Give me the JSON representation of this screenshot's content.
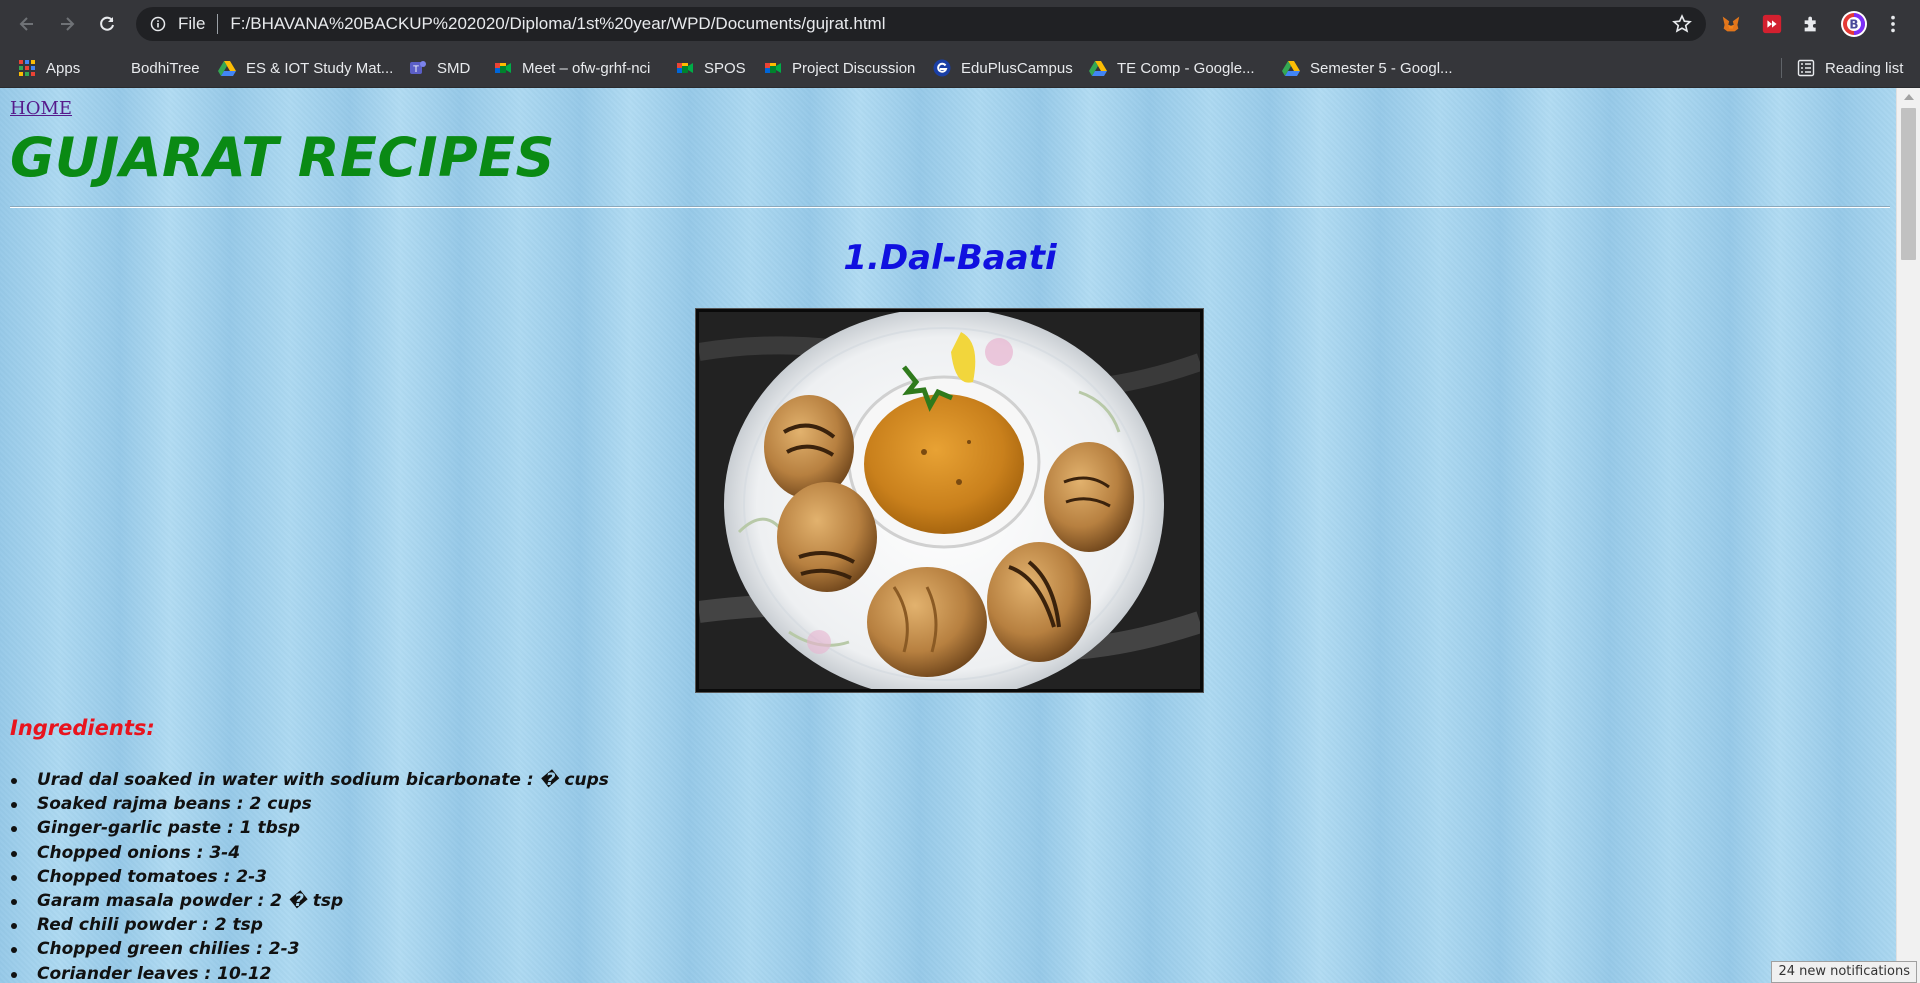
{
  "browser": {
    "scheme_label": "File",
    "url": "F:/BHAVANA%20BACKUP%202020/Diploma/1st%20year/WPD/Documents/gujrat.html",
    "profile_letter": "B"
  },
  "bookmarks": {
    "apps": "Apps",
    "items": [
      "BodhiTree",
      "ES & IOT Study Mat...",
      "SMD",
      "Meet – ofw-grhf-nci",
      "SPOS",
      "Project Discussion",
      "EduPlusCampus",
      "TE Comp - Google...",
      "Semester 5 - Googl..."
    ],
    "reading_list": "Reading list"
  },
  "page": {
    "home_link": "HOME",
    "title": "GUJARAT RECIPES",
    "dish_title": "1.Dal-Baati",
    "ingredients_heading": "Ingredients:",
    "ingredients": [
      "Urad dal soaked in water with sodium bicarbonate : � cups",
      "Soaked rajma beans : 2 cups",
      "Ginger-garlic paste : 1 tbsp",
      "Chopped onions : 3-4",
      "Chopped tomatoes : 2-3",
      "Garam masala powder : 2 � tsp",
      "Red chili powder : 2 tsp",
      "Chopped green chilies : 2-3",
      "Coriander leaves : 10-12"
    ]
  },
  "notification": "24 new notifications",
  "colors": {
    "title_green": "#0a8a14",
    "dish_blue": "#1010e0",
    "ingredients_red": "#e8141e",
    "page_bg": "#a6d4ee"
  }
}
